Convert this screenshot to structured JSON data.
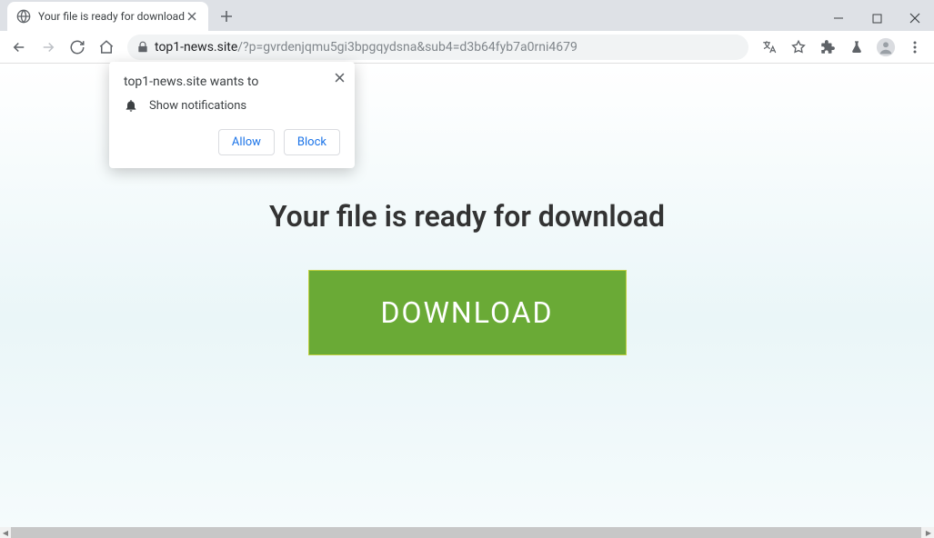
{
  "tab": {
    "title": "Your file is ready for download"
  },
  "address": {
    "host": "top1-news.site",
    "path": "/?p=gvrdenjqmu5gi3bpgqydsna&sub4=d3b64fyb7a0rni4679"
  },
  "notification": {
    "prompt": "top1-news.site wants to",
    "permission_label": "Show notifications",
    "allow_label": "Allow",
    "block_label": "Block"
  },
  "page": {
    "headline": "Your file is ready for download",
    "download_label": "DOWNLOAD"
  }
}
